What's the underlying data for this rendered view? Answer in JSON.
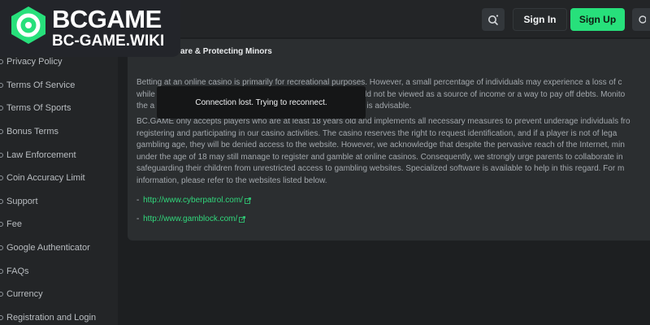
{
  "header": {
    "signin_label": "Sign In",
    "signup_label": "Sign Up",
    "search_icon": "search-icon",
    "menu_icon": "menu-icon"
  },
  "brand": {
    "title": "BCGAME",
    "subtitle": "BC-GAME.WIKI"
  },
  "sidebar": {
    "items": [
      {
        "label": "Privacy Policy"
      },
      {
        "label": "Terms Of Service"
      },
      {
        "label": "Terms Of Sports"
      },
      {
        "label": "Bonus Terms"
      },
      {
        "label": "Law Enforcement"
      },
      {
        "label": "Coin Accuracy Limit"
      },
      {
        "label": "Support"
      },
      {
        "label": "Fee"
      },
      {
        "label": "Google Authenticator"
      },
      {
        "label": "FAQs"
      },
      {
        "label": "Currency"
      },
      {
        "label": "Registration and Login"
      }
    ]
  },
  "content": {
    "title": "are & Protecting Minors",
    "para1": [
      "Betting at an online casino is primarily for recreational purposes. However, a small percentage of individuals may experience a loss of c",
      "while                                                                                         ould not be viewed as a source of income or a way to pay off debts. Monito",
      "the a                                                                                         no is advisable."
    ],
    "para2": [
      "BC.GAME only accepts players who are at least 18 years old and implements all necessary measures to prevent underage individuals fro",
      "registering and participating in our casino activities. The casino reserves the right to request identification, and if a player is not of lega",
      "gambling age, they will be denied access to the website. However, we acknowledge that despite the pervasive reach of the Internet, min",
      "under the age of 18 may still manage to register and gamble at online casinos. Consequently, we strongly urge parents to collaborate in",
      "safeguarding their children from unrestricted access to gambling websites. Specialized software is available to help in this regard. For m",
      "information, please refer to the websites listed below."
    ],
    "links": [
      {
        "prefix": "- ",
        "text": "http://www.cyberpatrol.com/"
      },
      {
        "prefix": "- ",
        "text": "http://www.gamblock.com/"
      }
    ]
  },
  "toast": {
    "message": "Connection lost. Trying to reconnect."
  },
  "colors": {
    "accent": "#27e07b",
    "link": "#31d87c",
    "background": "#1d1f21",
    "panel": "#2b2e30"
  }
}
